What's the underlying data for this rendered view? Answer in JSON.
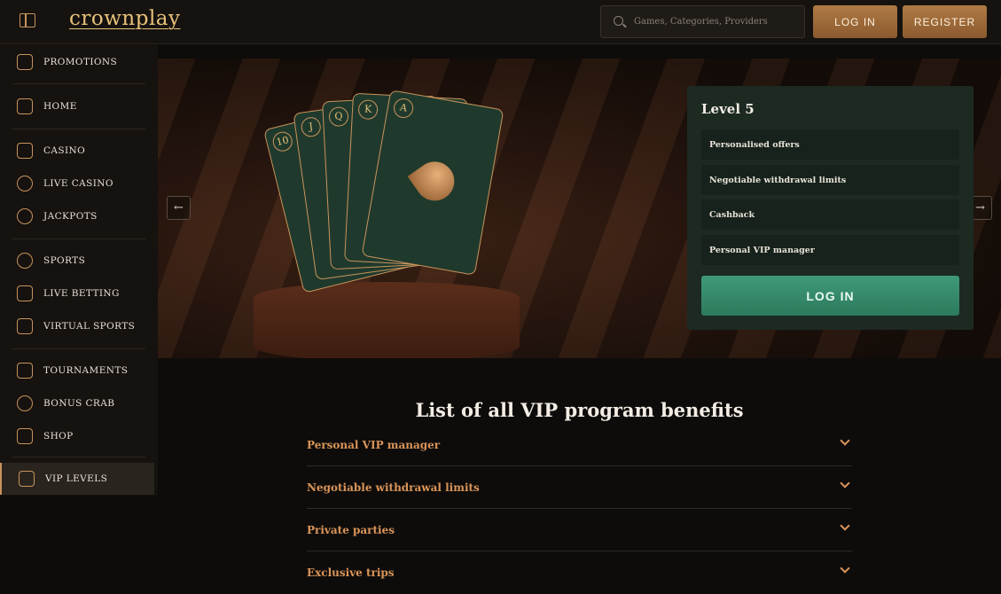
{
  "header": {
    "logo_text": "crownplay",
    "search_placeholder": "Games, Categories, Providers",
    "login_label": "LOG IN",
    "register_label": "REGISTER"
  },
  "sidebar": {
    "items": [
      {
        "label": "PROMOTIONS",
        "icon": "gift-icon"
      },
      {
        "label": "HOME",
        "icon": "home-icon"
      },
      {
        "label": "CASINO",
        "icon": "slot-machine-icon"
      },
      {
        "label": "LIVE CASINO",
        "icon": "spade-icon"
      },
      {
        "label": "JACKPOTS",
        "icon": "clover-icon"
      },
      {
        "label": "SPORTS",
        "icon": "soccer-ball-icon"
      },
      {
        "label": "LIVE BETTING",
        "icon": "live-betting-icon"
      },
      {
        "label": "VIRTUAL SPORTS",
        "icon": "gamepad-icon"
      },
      {
        "label": "TOURNAMENTS",
        "icon": "trophy-icon"
      },
      {
        "label": "BONUS CRAB",
        "icon": "crab-icon"
      },
      {
        "label": "SHOP",
        "icon": "shop-icon"
      },
      {
        "label": "VIP LEVELS",
        "icon": "crown-icon"
      }
    ]
  },
  "hero": {
    "card_ranks": [
      "10",
      "J",
      "Q",
      "K",
      "A"
    ],
    "prev_arrow": "←",
    "next_arrow": "→"
  },
  "level_panel": {
    "title": "Level 5",
    "perks": [
      "Personalised offers",
      "Negotiable withdrawal limits",
      "Cashback",
      "Personal VIP manager"
    ],
    "login_label": "LOG IN"
  },
  "benefits": {
    "title": "List of all VIP program benefits",
    "items": [
      "Personal VIP manager",
      "Negotiable withdrawal limits",
      "Private parties",
      "Exclusive trips"
    ]
  },
  "colors": {
    "accent_gold": "#c9935c",
    "benefit_text": "#d9955a",
    "panel_green": "#1c2a22",
    "login_green": "#3f9a78"
  }
}
